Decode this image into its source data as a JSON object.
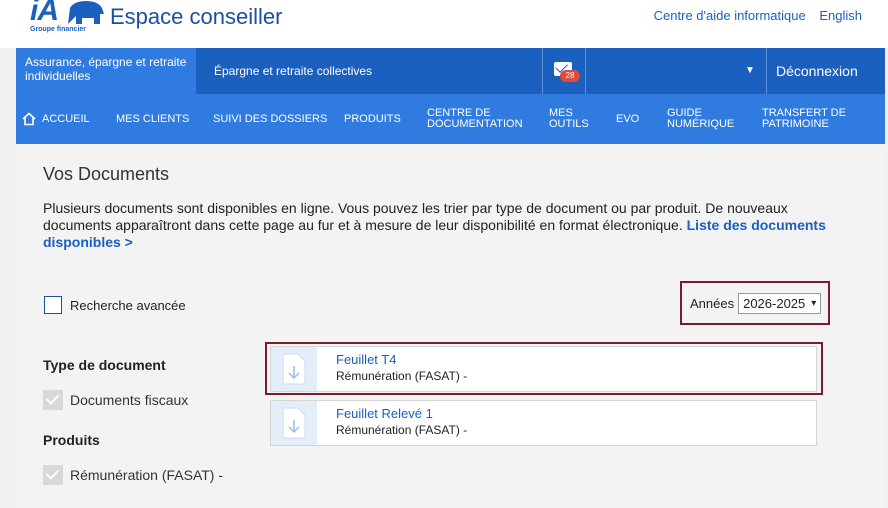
{
  "header": {
    "logo_text": "iA",
    "logo_sub": "Groupe financier",
    "title": "Espace conseiller",
    "links": [
      "Centre d'aide informatique",
      "English"
    ]
  },
  "nav_primary": {
    "active": "Assurance, épargne et retraite individuelles",
    "collective": "Épargne et retraite collectives",
    "mail_count": "28",
    "caret": "▼",
    "logout": "Déconnexion"
  },
  "nav_secondary": [
    "ACCUEIL",
    "MES CLIENTS",
    "SUIVI DES DOSSIERS",
    "PRODUITS",
    "CENTRE DE\nDOCUMENTATION",
    "MES\nOUTILS",
    "EVO",
    "GUIDE\nNUMÉRIQUE",
    "TRANSFERT DE\nPATRIMOINE"
  ],
  "content": {
    "heading": "Vos Documents",
    "intro": "Plusieurs documents sont disponibles en ligne. Vous pouvez les trier par type de document ou par produit. De nouveaux documents apparaîtront dans cette page au fur et à mesure de leur disponibilité en format électronique.",
    "intro_link": "Liste des documents disponibles >",
    "advanced_search": "Recherche avancée",
    "years_label": "Années",
    "years_value": "2026-2025",
    "filters": {
      "type_title": "Type de document",
      "type_item": "Documents fiscaux",
      "product_title": "Produits",
      "product_item": "Rémunération (FASAT) -"
    },
    "documents": [
      {
        "title": "Feuillet T4",
        "subtitle": "Rémunération (FASAT) -"
      },
      {
        "title": "Feuillet Relevé 1",
        "subtitle": "Rémunération (FASAT) -"
      }
    ]
  },
  "colors": {
    "brand_dark": "#1b5fbf",
    "brand_light": "#2f7be0",
    "highlight": "#7a1a2a",
    "badge": "#e04a3a"
  }
}
